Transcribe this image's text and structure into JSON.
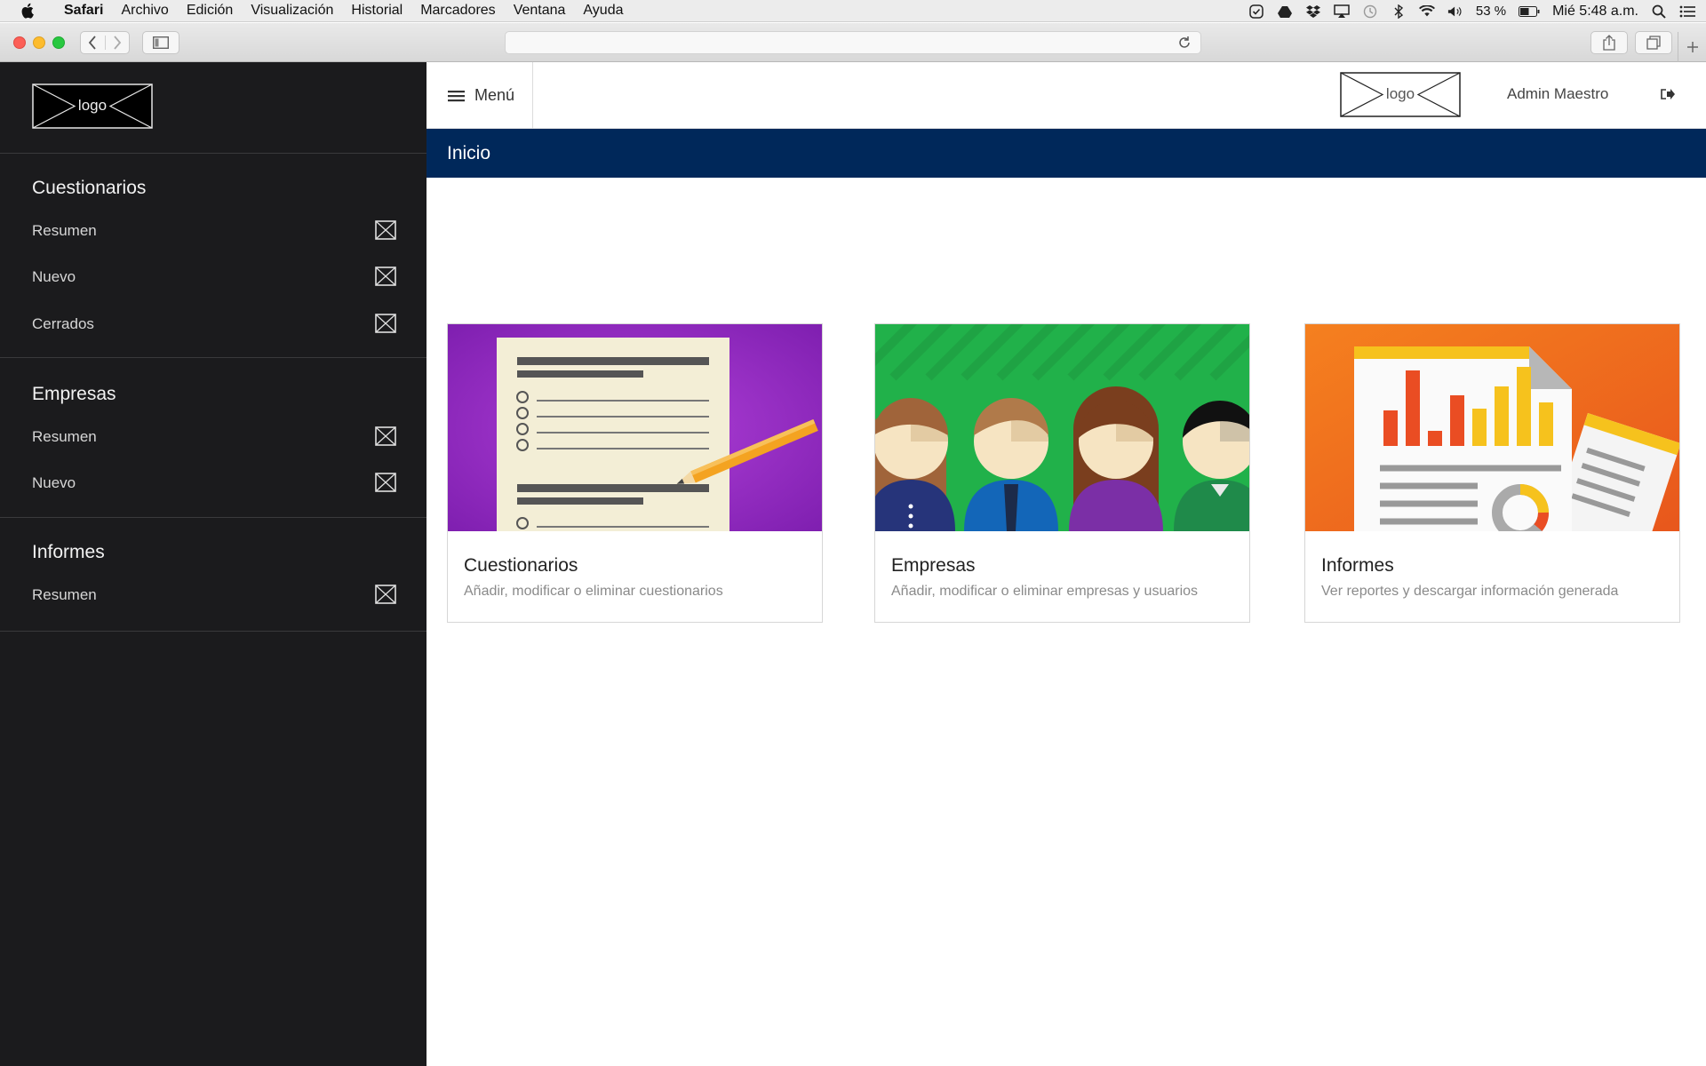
{
  "menubar": {
    "items": [
      "Safari",
      "Archivo",
      "Edición",
      "Visualización",
      "Historial",
      "Marcadores",
      "Ventana",
      "Ayuda"
    ],
    "battery": "53 %",
    "clock": "Mié 5:48 a.m."
  },
  "sidebar": {
    "logo_text": "logo",
    "groups": [
      {
        "title": "Cuestionarios",
        "items": [
          "Resumen",
          "Nuevo",
          "Cerrados"
        ]
      },
      {
        "title": "Empresas",
        "items": [
          "Resumen",
          "Nuevo"
        ]
      },
      {
        "title": "Informes",
        "items": [
          "Resumen"
        ]
      }
    ]
  },
  "header": {
    "menu_label": "Menú",
    "logo_text": "logo",
    "user_name": "Admin Maestro"
  },
  "page": {
    "title": "Inicio"
  },
  "cards": [
    {
      "title": "Cuestionarios",
      "description": "Añadir, modificar o eliminar cuestionarios"
    },
    {
      "title": "Empresas",
      "description": "Añadir, modificar o eliminar empresas y usuarios"
    },
    {
      "title": "Informes",
      "description": "Ver reportes y descargar información generada"
    }
  ],
  "colors": {
    "sidebar_bg": "#1b1b1d",
    "title_bar": "#00285a",
    "card_purple": "#9b2fc9",
    "card_green": "#21b14a",
    "card_orange": "#f07a1c"
  }
}
